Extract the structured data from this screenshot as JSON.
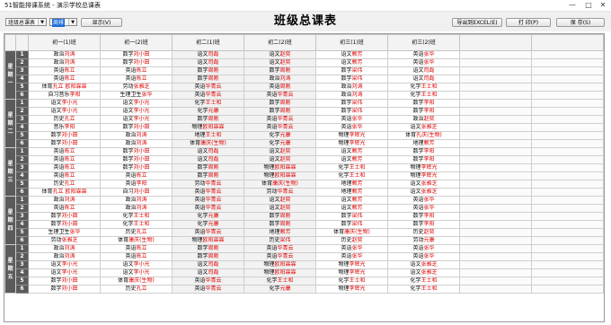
{
  "window": {
    "title": "51智能排课系统 - 演示学校总课表"
  },
  "toolbar": {
    "view_select": "班级总课表",
    "mode_select": "周排",
    "show_button": "显示(V)",
    "export_button": "导出到EXCEL(E)",
    "print_button": "打 印(P)",
    "save_button": "保 存(S)"
  },
  "page_title": "班级总课表",
  "classes": [
    "初一(1)班",
    "初一(2)班",
    "初二(1)班",
    "初二(2)班",
    "初三(1)班",
    "初三(2)班"
  ],
  "days": [
    "星期一",
    "星期二",
    "星期三",
    "星期四",
    "星期五"
  ],
  "periods": [
    "1",
    "2",
    "3",
    "4",
    "5",
    "6"
  ],
  "schedule": [
    [
      [
        {
          "l": "",
          "s": "政治",
          "t": "刘涛"
        },
        {
          "l": "",
          "s": "数学",
          "t": "刘小田"
        },
        {
          "l": "",
          "s": "语文",
          "t": "司磊"
        },
        {
          "l": "",
          "s": "语文",
          "t": "赵奕"
        },
        {
          "l": "",
          "s": "语文",
          "t": "赖芳"
        },
        {
          "l": "",
          "s": "英语",
          "t": "张华"
        }
      ],
      [
        {
          "l": "",
          "s": "政治",
          "t": "刘涛"
        },
        {
          "l": "",
          "s": "数学",
          "t": "刘小田"
        },
        {
          "l": "",
          "s": "语文",
          "t": "司磊"
        },
        {
          "l": "",
          "s": "语文",
          "t": "赵奕"
        },
        {
          "l": "",
          "s": "语文",
          "t": "赖芳"
        },
        {
          "l": "",
          "s": "英语",
          "t": "张华"
        }
      ],
      [
        {
          "l": "",
          "s": "英语",
          "t": "陈立"
        },
        {
          "l": "",
          "s": "英语",
          "t": "陈立"
        },
        {
          "l": "",
          "s": "数学",
          "t": "周刚"
        },
        {
          "l": "",
          "s": "数学",
          "t": "周刚"
        },
        {
          "l": "",
          "s": "数学",
          "t": "梁伟"
        },
        {
          "l": "",
          "s": "语文",
          "t": "司磊"
        }
      ],
      [
        {
          "l": "",
          "s": "英语",
          "t": "陈立"
        },
        {
          "l": "",
          "s": "英语",
          "t": "陈立"
        },
        {
          "l": "",
          "s": "数学",
          "t": "周刚"
        },
        {
          "l": "",
          "s": "政治",
          "t": "刘涛"
        },
        {
          "l": "",
          "s": "数学",
          "t": "梁伟"
        },
        {
          "l": "",
          "s": "语文",
          "t": "司磊"
        }
      ],
      [
        {
          "l": "",
          "s": "体育",
          "t": "孔立 欧阳霖霖"
        },
        {
          "l": "",
          "s": "劳动",
          "t": "张雅芝"
        },
        {
          "l": "",
          "s": "英语",
          "t": "华青云"
        },
        {
          "l": "",
          "s": "英语",
          "t": "周刚"
        },
        {
          "l": "",
          "s": "政治",
          "t": "刘涛"
        },
        {
          "l": "",
          "s": "化学",
          "t": "王士和"
        }
      ],
      [
        {
          "l": "自习",
          "s": "音乐",
          "t": "李阳"
        },
        {
          "l": "生理卫生",
          "s": "",
          "t": "张华"
        },
        {
          "l": "",
          "s": "英语",
          "t": "华青云"
        },
        {
          "l": "",
          "s": "英语",
          "t": "华青云"
        },
        {
          "l": "",
          "s": "政治",
          "t": "刘涛"
        },
        {
          "l": "",
          "s": "化学",
          "t": "王士和"
        }
      ]
    ],
    [
      [
        {
          "l": "",
          "s": "语文",
          "t": "李小光"
        },
        {
          "l": "",
          "s": "语文",
          "t": "李小光"
        },
        {
          "l": "",
          "s": "化学",
          "t": "王士和"
        },
        {
          "l": "",
          "s": "数学",
          "t": "周刚"
        },
        {
          "l": "",
          "s": "数学",
          "t": "梁伟"
        },
        {
          "l": "",
          "s": "数学",
          "t": "李阳"
        }
      ],
      [
        {
          "l": "",
          "s": "语文",
          "t": "李小光"
        },
        {
          "l": "",
          "s": "语文",
          "t": "李小光"
        },
        {
          "l": "",
          "s": "化学",
          "t": "元康"
        },
        {
          "l": "",
          "s": "数学",
          "t": "周刚"
        },
        {
          "l": "",
          "s": "数学",
          "t": "梁伟"
        },
        {
          "l": "",
          "s": "数学",
          "t": "李阳"
        }
      ],
      [
        {
          "l": "",
          "s": "历史",
          "t": "孔立"
        },
        {
          "l": "",
          "s": "语文",
          "t": "李小光"
        },
        {
          "l": "",
          "s": "数学",
          "t": "周刚"
        },
        {
          "l": "",
          "s": "英语",
          "t": "华青云"
        },
        {
          "l": "",
          "s": "英语",
          "t": "张华"
        },
        {
          "l": "",
          "s": "政治",
          "t": "赵奕"
        }
      ],
      [
        {
          "l": "音乐",
          "s": "",
          "t": "李阳"
        },
        {
          "l": "",
          "s": "数学",
          "t": "刘小田"
        },
        {
          "l": "",
          "s": "物理",
          "t": "欧阳霖霖"
        },
        {
          "l": "",
          "s": "英语",
          "t": "华青云"
        },
        {
          "l": "",
          "s": "英语",
          "t": "张华"
        },
        {
          "l": "",
          "s": "语文",
          "t": "张雅芝"
        }
      ],
      [
        {
          "l": "",
          "s": "数学",
          "t": "刘小田"
        },
        {
          "l": "",
          "s": "政治",
          "t": "刘涛"
        },
        {
          "l": "",
          "s": "地理",
          "t": "王士和"
        },
        {
          "l": "",
          "s": "化学",
          "t": "元康"
        },
        {
          "l": "",
          "s": "物理",
          "t": "李辉光"
        },
        {
          "l": "",
          "s": "体育",
          "t": "孔庆(生物)"
        }
      ],
      [
        {
          "l": "",
          "s": "数学",
          "t": "刘小田"
        },
        {
          "l": "",
          "s": "政治",
          "t": "刘涛"
        },
        {
          "l": "",
          "s": "体育",
          "t": "康庆(生物)"
        },
        {
          "l": "",
          "s": "化学",
          "t": "元康"
        },
        {
          "l": "",
          "s": "物理",
          "t": "李辉光"
        },
        {
          "l": "",
          "s": "地理",
          "t": "赖芳"
        }
      ]
    ],
    [
      [
        {
          "l": "",
          "s": "英语",
          "t": "陈立"
        },
        {
          "l": "",
          "s": "数学",
          "t": "刘小田"
        },
        {
          "l": "",
          "s": "语文",
          "t": "司磊"
        },
        {
          "l": "",
          "s": "语文",
          "t": "赵奕"
        },
        {
          "l": "",
          "s": "语文",
          "t": "赖芳"
        },
        {
          "l": "",
          "s": "数学",
          "t": "李阳"
        }
      ],
      [
        {
          "l": "",
          "s": "英语",
          "t": "陈立"
        },
        {
          "l": "",
          "s": "数学",
          "t": "刘小田"
        },
        {
          "l": "",
          "s": "语文",
          "t": "司磊"
        },
        {
          "l": "",
          "s": "语文",
          "t": "赵奕"
        },
        {
          "l": "",
          "s": "语文",
          "t": "赖芳"
        },
        {
          "l": "",
          "s": "数学",
          "t": "李阳"
        }
      ],
      [
        {
          "l": "",
          "s": "英语",
          "t": "陈立"
        },
        {
          "l": "",
          "s": "数学",
          "t": "刘小田"
        },
        {
          "l": "",
          "s": "数学",
          "t": "周刚"
        },
        {
          "l": "",
          "s": "物理",
          "t": "欧阳霖霖"
        },
        {
          "l": "",
          "s": "化学",
          "t": "王士和"
        },
        {
          "l": "",
          "s": "物理",
          "t": "李辉光"
        }
      ],
      [
        {
          "l": "",
          "s": "英语",
          "t": "陈立"
        },
        {
          "l": "",
          "s": "英语",
          "t": "陈立"
        },
        {
          "l": "",
          "s": "数学",
          "t": "周刚"
        },
        {
          "l": "",
          "s": "物理",
          "t": "欧阳霖霖"
        },
        {
          "l": "",
          "s": "化学",
          "t": "王士和"
        },
        {
          "l": "",
          "s": "物理",
          "t": "李辉光"
        }
      ],
      [
        {
          "l": "",
          "s": "历史",
          "t": "孔立"
        },
        {
          "l": "",
          "s": "英语",
          "t": "李阳"
        },
        {
          "l": "",
          "s": "劳动",
          "t": "华青云"
        },
        {
          "l": "",
          "s": "体育",
          "t": "康庆(生物)"
        },
        {
          "l": "",
          "s": "地理",
          "t": "赖芳"
        },
        {
          "l": "",
          "s": "语文",
          "t": "张雅芝"
        }
      ],
      [
        {
          "l": "",
          "s": "体育",
          "t": "孔立 欧阳霖霖"
        },
        {
          "l": "",
          "s": "自习",
          "t": "刘小田"
        },
        {
          "l": "",
          "s": "英语",
          "t": "华青云"
        },
        {
          "l": "",
          "s": "劳动",
          "t": "华青云"
        },
        {
          "l": "",
          "s": "地理",
          "t": "赖芳"
        },
        {
          "l": "",
          "s": "语文",
          "t": "张雅芝"
        }
      ]
    ],
    [
      [
        {
          "l": "",
          "s": "政治",
          "t": "刘涛"
        },
        {
          "l": "",
          "s": "政治",
          "t": "刘涛"
        },
        {
          "l": "",
          "s": "英语",
          "t": "华青云"
        },
        {
          "l": "",
          "s": "语文",
          "t": "赵奕"
        },
        {
          "l": "",
          "s": "语文",
          "t": "赖芳"
        },
        {
          "l": "",
          "s": "英语",
          "t": "张华"
        }
      ],
      [
        {
          "l": "",
          "s": "英语",
          "t": "陈立"
        },
        {
          "l": "",
          "s": "政治",
          "t": "刘涛"
        },
        {
          "l": "",
          "s": "英语",
          "t": "华青云"
        },
        {
          "l": "",
          "s": "语文",
          "t": "赵奕"
        },
        {
          "l": "",
          "s": "语文",
          "t": "赖芳"
        },
        {
          "l": "",
          "s": "英语",
          "t": "张华"
        }
      ],
      [
        {
          "l": "",
          "s": "数学",
          "t": "刘小田"
        },
        {
          "l": "",
          "s": "化学",
          "t": "王士和"
        },
        {
          "l": "",
          "s": "化学",
          "t": "元康"
        },
        {
          "l": "",
          "s": "数学",
          "t": "周刚"
        },
        {
          "l": "",
          "s": "数学",
          "t": "梁伟"
        },
        {
          "l": "",
          "s": "数学",
          "t": "李阳"
        }
      ],
      [
        {
          "l": "",
          "s": "数学",
          "t": "刘小田"
        },
        {
          "l": "",
          "s": "化学",
          "t": "王士和"
        },
        {
          "l": "",
          "s": "化学",
          "t": "元康"
        },
        {
          "l": "",
          "s": "数学",
          "t": "周刚"
        },
        {
          "l": "",
          "s": "数学",
          "t": "梁伟"
        },
        {
          "l": "",
          "s": "数学",
          "t": "李阳"
        }
      ],
      [
        {
          "l": "",
          "s": "生理卫生",
          "t": "张华"
        },
        {
          "l": "",
          "s": "历史",
          "t": "孔立"
        },
        {
          "l": "",
          "s": "英语",
          "t": "华青云"
        },
        {
          "l": "",
          "s": "地理",
          "t": "赖芳"
        },
        {
          "l": "",
          "s": "体育",
          "t": "康庆(生物)"
        },
        {
          "l": "",
          "s": "历史",
          "t": "赵奕"
        }
      ],
      [
        {
          "l": "",
          "s": "劳动",
          "t": "张雅芝"
        },
        {
          "l": "",
          "s": "体育",
          "t": "康庆(生物)"
        },
        {
          "l": "",
          "s": "物理",
          "t": "欧阳霖霖"
        },
        {
          "l": "",
          "s": "历史",
          "t": "梁伟"
        },
        {
          "l": "",
          "s": "历史",
          "t": "赵奕"
        },
        {
          "l": "",
          "s": "劳动",
          "t": "元康"
        }
      ]
    ],
    [
      [
        {
          "l": "",
          "s": "政治",
          "t": "刘涛"
        },
        {
          "l": "",
          "s": "英语",
          "t": "陈立"
        },
        {
          "l": "",
          "s": "数学",
          "t": "周刚"
        },
        {
          "l": "",
          "s": "英语",
          "t": "华青云"
        },
        {
          "l": "",
          "s": "英语",
          "t": "张华"
        },
        {
          "l": "",
          "s": "英语",
          "t": "张华"
        }
      ],
      [
        {
          "l": "",
          "s": "政治",
          "t": "刘涛"
        },
        {
          "l": "",
          "s": "英语",
          "t": "陈立"
        },
        {
          "l": "",
          "s": "数学",
          "t": "周刚"
        },
        {
          "l": "",
          "s": "英语",
          "t": "华青云"
        },
        {
          "l": "",
          "s": "英语",
          "t": "张华"
        },
        {
          "l": "",
          "s": "英语",
          "t": "张华"
        }
      ],
      [
        {
          "l": "",
          "s": "语文",
          "t": "李小光"
        },
        {
          "l": "",
          "s": "语文",
          "t": "李小光"
        },
        {
          "l": "",
          "s": "语文",
          "t": "司磊"
        },
        {
          "l": "",
          "s": "物理",
          "t": "欧阳霖霖"
        },
        {
          "l": "",
          "s": "物理",
          "t": "李辉光"
        },
        {
          "l": "",
          "s": "语文",
          "t": "张雅芝"
        }
      ],
      [
        {
          "l": "",
          "s": "语文",
          "t": "李小光"
        },
        {
          "l": "",
          "s": "语文",
          "t": "李小光"
        },
        {
          "l": "",
          "s": "语文",
          "t": "司磊"
        },
        {
          "l": "",
          "s": "物理",
          "t": "欧阳霖霖"
        },
        {
          "l": "",
          "s": "物理",
          "t": "李辉光"
        },
        {
          "l": "",
          "s": "语文",
          "t": "张雅芝"
        }
      ],
      [
        {
          "l": "",
          "s": "数学",
          "t": "刘小田"
        },
        {
          "l": "",
          "s": "体育",
          "t": "康庆(生物)"
        },
        {
          "l": "",
          "s": "英语",
          "t": "华青云"
        },
        {
          "l": "",
          "s": "化学",
          "t": "王士和"
        },
        {
          "l": "",
          "s": "化学",
          "t": "王士和"
        },
        {
          "l": "",
          "s": "化学",
          "t": "王士和"
        }
      ],
      [
        {
          "l": "",
          "s": "数学",
          "t": "刘小田"
        },
        {
          "l": "",
          "s": "历史",
          "t": "孔立"
        },
        {
          "l": "",
          "s": "英语",
          "t": "华青云"
        },
        {
          "l": "",
          "s": "化学",
          "t": "元康"
        },
        {
          "l": "",
          "s": "物理",
          "t": "李辉光"
        },
        {
          "l": "",
          "s": "化学",
          "t": "王士和"
        }
      ]
    ]
  ],
  "colors": {
    "teacher": "#e00000",
    "day_cell": "#5b5b5b",
    "header_bg": "#f3f3f3",
    "select_highlight": "#1a6dd8"
  }
}
